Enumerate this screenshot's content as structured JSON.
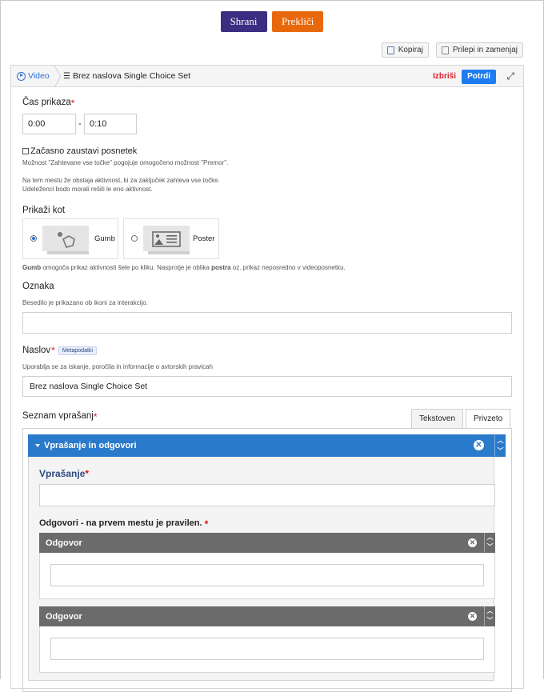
{
  "toolbar": {
    "save_label": "Shrani",
    "cancel_label": "Prekliči",
    "copy_label": "Kopiraj",
    "paste_label": "Prilepi in zamenjaj"
  },
  "editor": {
    "crumb_video": "Video",
    "crumb_title": "Brez naslova Single Choice Set",
    "delete_label": "Izbriši",
    "confirm_label": "Potrdi"
  },
  "time": {
    "label": "Čas prikaza",
    "start": "0:00",
    "end": "0:10",
    "separator": "-"
  },
  "pause": {
    "label": "Začasno zaustavi posnetek",
    "desc1": "Možnost \"Zahtevane vse točke\" pogojuje omogočeno možnost \"Premor\".",
    "desc2": "Na tem mestu že obstaja aktivnost, ki za zaključek zahteva vse točke.",
    "desc3": "Udeleženci bodo morali rešiti le eno aktivnost."
  },
  "display_as": {
    "label": "Prikaži kot",
    "options": [
      {
        "name": "Gumb",
        "selected": true
      },
      {
        "name": "Poster",
        "selected": false
      }
    ],
    "desc_bold1": "Gumb",
    "desc_mid": " omogoča prikaz aktivnosti šele po kliku. Nasprotje je oblika ",
    "desc_bold2": "postra",
    "desc_end": " oz. prikaz neposredno v videoposnetku."
  },
  "label_field": {
    "label": "Oznaka",
    "desc": "Besedilo je prikazano ob ikoni za interakcijo.",
    "value": ""
  },
  "title_field": {
    "label": "Naslov",
    "badge": "Metapodatki",
    "desc": "Uporablja se za iskanje, poročila in informacije o avtorskih pravicah",
    "value": "Brez naslova Single Choice Set"
  },
  "questions": {
    "label": "Seznam vprašanj",
    "tab_text": "Tekstoven",
    "tab_default": "Privzeto",
    "group_title": "Vprašanje in odgovori",
    "question_label": "Vprašanje",
    "question_value": "",
    "answers_label": "Odgovori - na prvem mestu je pravilen.",
    "answers": [
      {
        "title": "Odgovor",
        "value": ""
      },
      {
        "title": "Odgovor",
        "value": ""
      }
    ]
  },
  "colors": {
    "save": "#3b2d82",
    "cancel": "#e8690d",
    "accent": "#2a7acb",
    "answer_header": "#6b6b6b",
    "required": "#dd1111"
  }
}
